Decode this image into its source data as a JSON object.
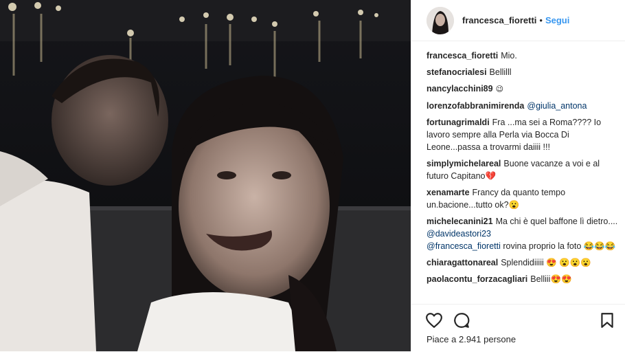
{
  "post": {
    "author": "francesca_fioretti",
    "separator": "•",
    "follow_label": "Segui"
  },
  "comments": [
    {
      "user": "francesca_fioretti",
      "text": "Mio."
    },
    {
      "user": "stefanocrialesi",
      "text": "Bellilll"
    },
    {
      "user": "nancylacchini89",
      "text": "😉"
    },
    {
      "user": "lorenzofabbranimirenda",
      "mention": "@giulia_antona"
    },
    {
      "user": "fortunagrimaldi",
      "text": "Fra ...ma sei a Roma???? Io lavoro sempre alla Perla via Bocca Di Leone...passa a trovarmi daiiii !!!"
    },
    {
      "user": "simplymichelareal",
      "text": "Buone vacanze a voi e al futuro Capitano💔"
    },
    {
      "user": "xenamarte",
      "text": "Francy da quanto tempo un.bacione...tutto ok?😮"
    },
    {
      "user": "michelecanini21",
      "text": "Ma chi è quel baffone lì dietro....",
      "mention": "@davideastori23",
      "mention2": "@francesca_fioretti",
      "text2": "rovina proprio la foto 😂😂😂"
    },
    {
      "user": "chiaragattonareal",
      "text": "Splendidiiiii 😍 😮😮😮"
    },
    {
      "user": "paolacontu_forzacagliari",
      "text": "Belliii😍😍"
    }
  ],
  "actions": {
    "like_icon": "heart-icon",
    "comment_icon": "speech-bubble-icon",
    "save_icon": "bookmark-icon",
    "likes_text": "Piace a 2.941 persone"
  }
}
